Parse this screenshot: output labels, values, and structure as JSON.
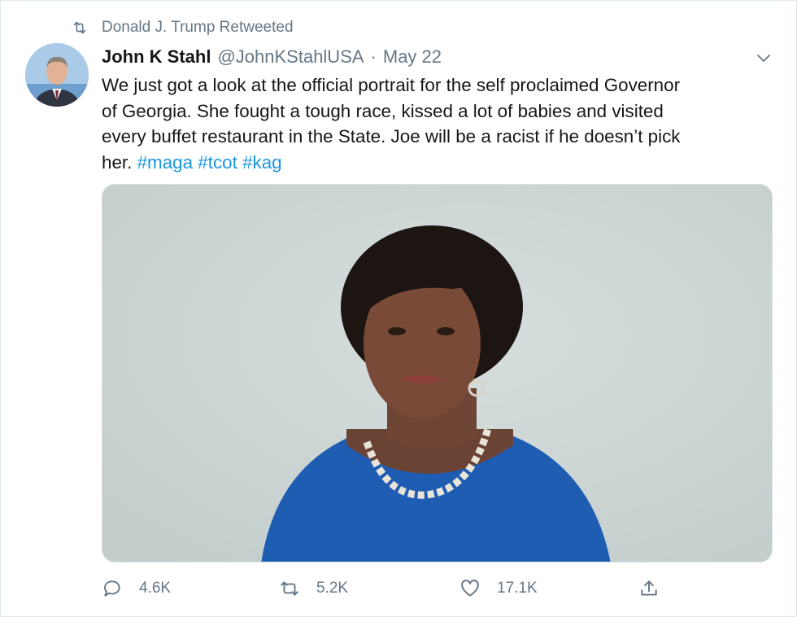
{
  "retweet_banner": {
    "text": "Donald J. Trump Retweeted",
    "icon": "retweet-icon"
  },
  "tweet": {
    "display_name": "John K Stahl",
    "handle": "@JohnKStahlUSA",
    "separator": "·",
    "date": "May 22",
    "text_lines": [
      "We just got a look at the official portrait for the self proclaimed Governor",
      "of Georgia. She fought a tough race, kissed a lot of babies and visited",
      "every buffet restaurant in the State. Joe will be a racist if he doesn’t pick",
      "her."
    ],
    "hashtags": [
      "#maga",
      "#tcot",
      "#kag"
    ]
  },
  "actions": {
    "reply": {
      "count": "4.6K",
      "icon": "reply-icon"
    },
    "retweet": {
      "count": "5.2K",
      "icon": "retweet-icon"
    },
    "like": {
      "count": "17.1K",
      "icon": "heart-icon"
    },
    "share": {
      "icon": "share-icon"
    }
  },
  "colors": {
    "text": "#14171a",
    "secondary": "#657786",
    "link": "#1b95e0"
  }
}
